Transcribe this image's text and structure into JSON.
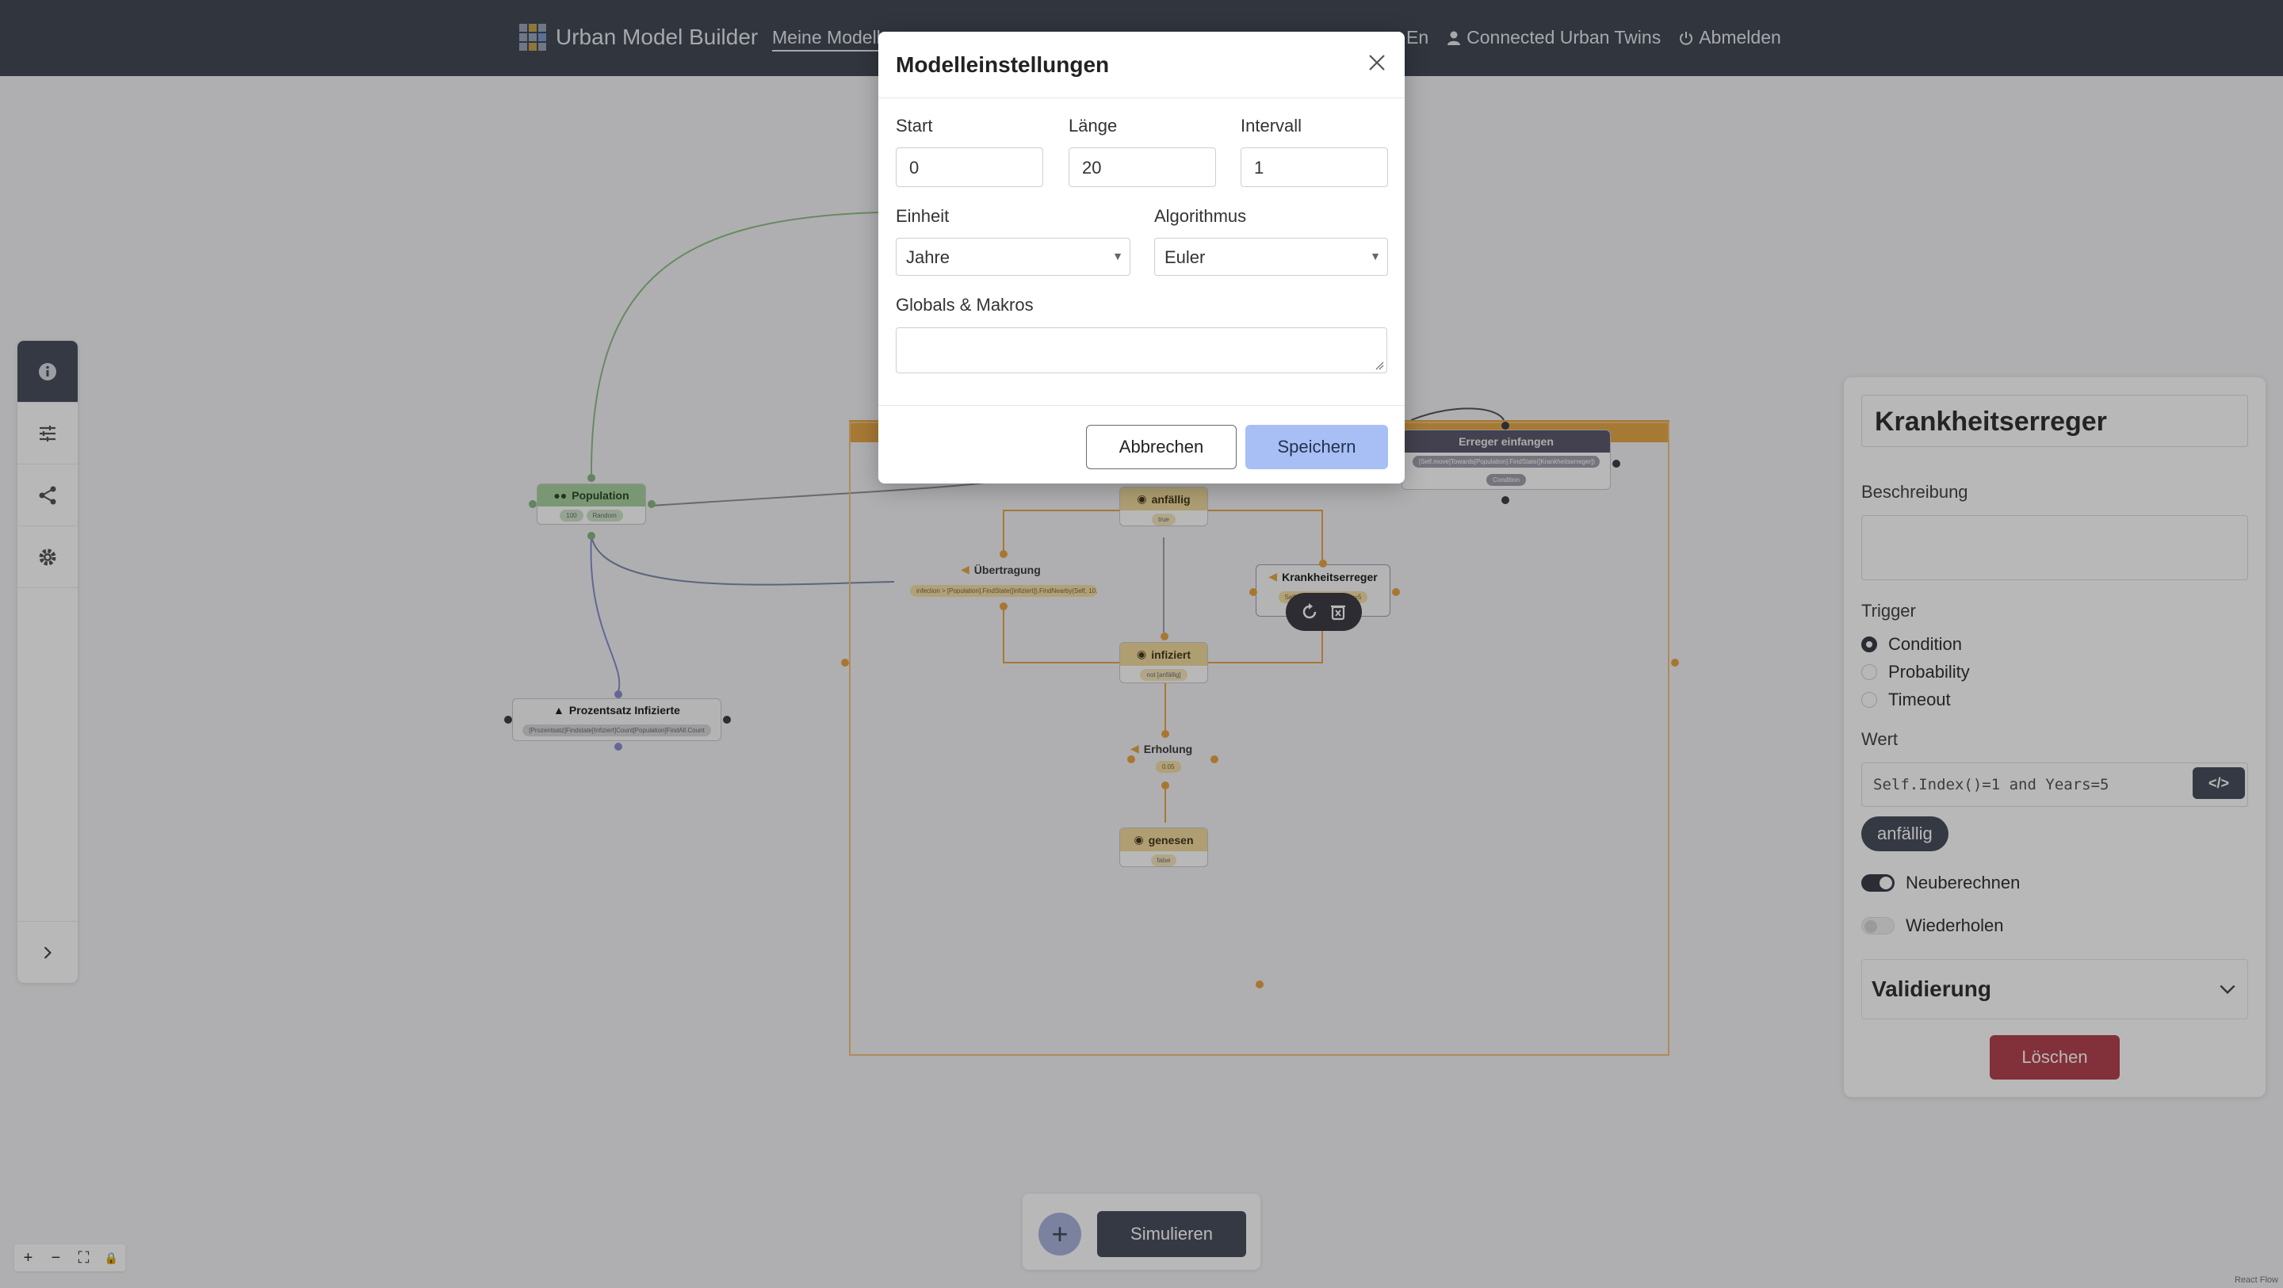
{
  "header": {
    "app_title": "Urban Model Builder",
    "nav_active": "Meine Modelle",
    "language": "En",
    "user": "Connected Urban Twins",
    "logout": "Abmelden"
  },
  "canvas": {
    "nodes": {
      "population": {
        "title": "Population",
        "pills": [
          "100",
          "Random"
        ]
      },
      "prozentsatz": {
        "title": "Prozentsatz Infizierte",
        "pill": "[Prozentsatz]Findstate[Infiziert]Count[Population]FindAll.Count"
      },
      "anfaellig": {
        "title": "anfällig",
        "pill": "true"
      },
      "infiziert": {
        "title": "infiziert",
        "pill": "not [anfällig]"
      },
      "genesen": {
        "title": "genesen",
        "pill": "false"
      },
      "erreger": {
        "title": "Erreger einfangen",
        "pills": [
          "[Self.move]Towards[Population].FindState([Krankheitserreger])",
          "Condition"
        ]
      },
      "krankheitserreger": {
        "title": "Krankheitserreger",
        "pill": "Self.Index()=1 and Years=5"
      }
    },
    "flows": {
      "uebertragung": {
        "label": "Übertragung",
        "pill": "infection > [Population].FindState([infiziert]).FindNearby(Self, 10, pro..."
      },
      "erholung": {
        "label": "Erholung",
        "pill": "0.05"
      }
    }
  },
  "right_panel": {
    "title": "Krankheitserreger",
    "description_label": "Beschreibung",
    "trigger_label": "Trigger",
    "trigger_options": [
      "Condition",
      "Probability",
      "Timeout"
    ],
    "trigger_selected": "Condition",
    "value_label": "Wert",
    "value_code": "Self.Index()=1 and Years=5",
    "code_button": "</>",
    "target_chip": "anfällig",
    "recalculate_label": "Neuberechnen",
    "recalculate_on": true,
    "repeat_label": "Wiederholen",
    "repeat_on": false,
    "validation_label": "Validierung",
    "delete_label": "Löschen"
  },
  "bottom_bar": {
    "add": "+",
    "simulate": "Simulieren"
  },
  "flow_controls": [
    "+",
    "−",
    "⛶",
    "🔒"
  ],
  "attribution": "React Flow",
  "modal": {
    "title": "Modelleinstellungen",
    "start_label": "Start",
    "start_value": "0",
    "length_label": "Länge",
    "length_value": "20",
    "interval_label": "Intervall",
    "interval_value": "1",
    "unit_label": "Einheit",
    "unit_value": "Jahre",
    "algorithm_label": "Algorithmus",
    "algorithm_value": "Euler",
    "globals_label": "Globals & Makros",
    "globals_value": "",
    "cancel_label": "Abbrechen",
    "save_label": "Speichern"
  },
  "colors": {
    "nav_bg": "#434a57",
    "accent_orange": "#e7a84a",
    "save_button": "#a7bff5",
    "delete_button": "#b5434f"
  }
}
